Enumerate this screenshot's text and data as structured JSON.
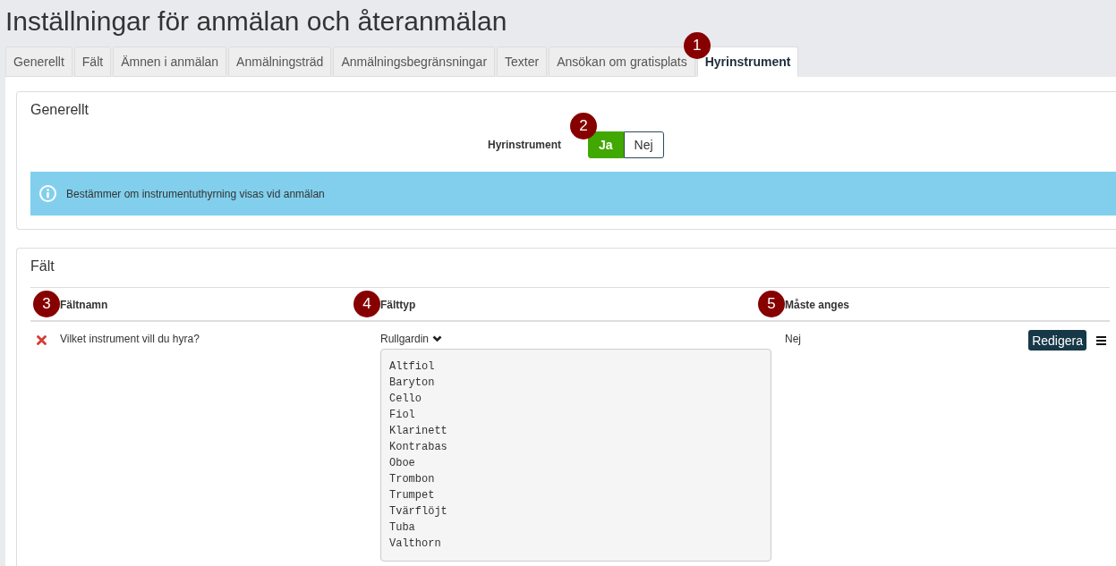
{
  "page": {
    "title": "Inställningar för anmälan och återanmälan"
  },
  "tabs": [
    {
      "label": "Generellt",
      "selected": false
    },
    {
      "label": "Fält",
      "selected": false
    },
    {
      "label": "Ämnen i anmälan",
      "selected": false
    },
    {
      "label": "Anmälningsträd",
      "selected": false
    },
    {
      "label": "Anmälningsbegränsningar",
      "selected": false
    },
    {
      "label": "Texter",
      "selected": false
    },
    {
      "label": "Ansökan om gratisplats",
      "selected": false
    },
    {
      "label": "Hyrinstrument",
      "selected": true,
      "callout": "1"
    }
  ],
  "general_panel": {
    "title": "Generellt",
    "setting": {
      "label": "Hyrinstrument",
      "callout": "2",
      "options": [
        {
          "label": "Ja",
          "selected": true
        },
        {
          "label": "Nej",
          "selected": false
        }
      ]
    },
    "info": "Bestämmer om instrumentuthyrning visas vid anmälan"
  },
  "fields_panel": {
    "title": "Fält",
    "columns": [
      {
        "label": "Fältnamn",
        "callout": "3"
      },
      {
        "label": "Fälttyp",
        "callout": "4"
      },
      {
        "label": "Måste anges",
        "callout": "5"
      }
    ],
    "rows": [
      {
        "name": "Vilket instrument vill du hyra?",
        "type": "Rullgardin",
        "expanded": true,
        "options": [
          "Altfiol",
          "Baryton",
          "Cello",
          "Fiol",
          "Klarinett",
          "Kontrabas",
          "Oboe",
          "Trombon",
          "Trumpet",
          "Tvärflöjt",
          "Tuba",
          "Valthorn"
        ],
        "required": "Nej",
        "action": "Redigera"
      }
    ]
  }
}
